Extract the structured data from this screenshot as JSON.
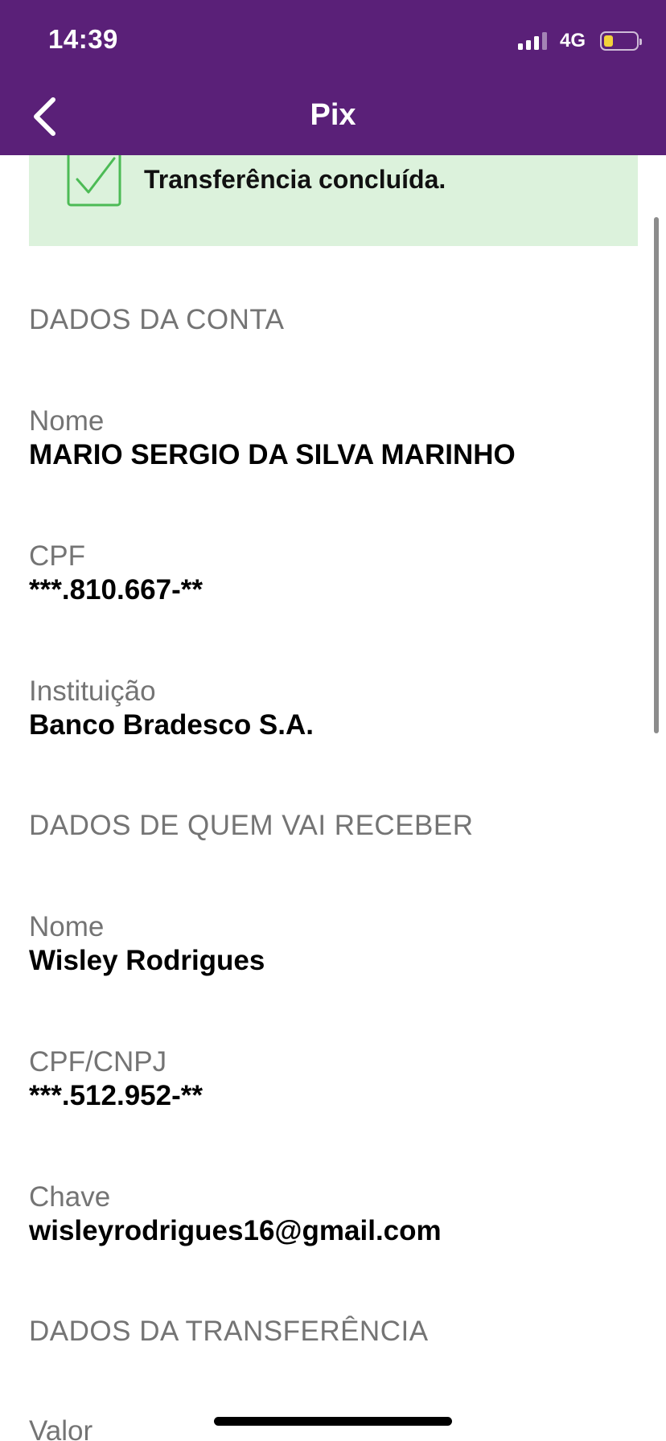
{
  "status_bar": {
    "time": "14:39",
    "network": "4G"
  },
  "header": {
    "title": "Pix"
  },
  "banner": {
    "message": "Transferência concluída."
  },
  "account_section": {
    "title": "DADOS DA CONTA",
    "name_label": "Nome",
    "name_value": "MARIO SERGIO DA SILVA MARINHO",
    "cpf_label": "CPF",
    "cpf_value": "***.810.667-**",
    "institution_label": "Instituição",
    "institution_value": "Banco Bradesco S.A."
  },
  "recipient_section": {
    "title": "DADOS DE QUEM VAI RECEBER",
    "name_label": "Nome",
    "name_value": "Wisley Rodrigues",
    "doc_label": "CPF/CNPJ",
    "doc_value": "***.512.952-**",
    "key_label": "Chave",
    "key_value": "wisleyrodrigues16@gmail.com"
  },
  "transfer_section": {
    "title": "DADOS DA TRANSFERÊNCIA",
    "value_label": "Valor"
  },
  "colors": {
    "header_bg": "#5a2078",
    "banner_bg": "#dcf2dc",
    "success_green": "#4cbb55",
    "label_gray": "#747474"
  },
  "icons": {
    "back": "chevron-left-icon",
    "success": "checkbox-check-icon",
    "signal": "signal-icon",
    "battery": "battery-icon"
  },
  "battery_level": 0.3
}
